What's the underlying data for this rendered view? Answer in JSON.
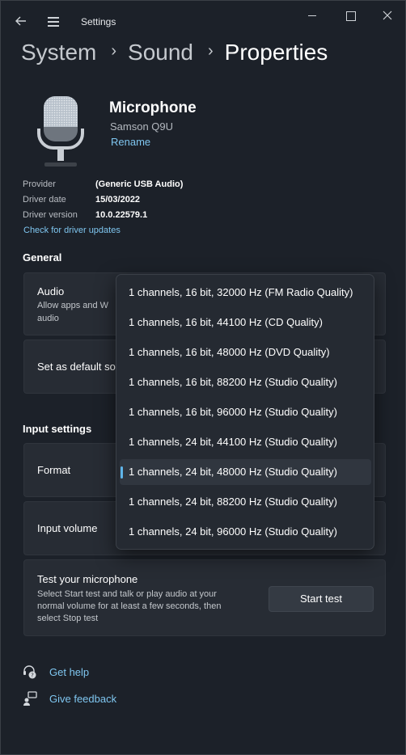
{
  "titlebar": {
    "title": "Settings",
    "back_icon": "back-arrow-icon",
    "menu_icon": "hamburger-icon"
  },
  "breadcrumb": {
    "items": [
      "System",
      "Sound",
      "Properties"
    ],
    "separator": "›"
  },
  "device": {
    "name": "Microphone",
    "model": "Samson Q9U",
    "rename_label": "Rename",
    "properties": [
      {
        "label": "Provider",
        "value": "(Generic USB Audio)"
      },
      {
        "label": "Driver date",
        "value": "15/03/2022"
      },
      {
        "label": "Driver version",
        "value": "10.0.22579.1"
      }
    ],
    "driver_update_link": "Check for driver updates"
  },
  "general": {
    "title": "General",
    "audio_title": "Audio",
    "audio_sub_1": "Allow apps and W",
    "audio_sub_2": "audio",
    "default_label": "Set as default so"
  },
  "input_settings": {
    "title": "Input settings",
    "format_label": "Format",
    "volume_label": "Input volume"
  },
  "test": {
    "title": "Test your microphone",
    "desc_1": "Select Start test and talk or play audio at your",
    "desc_2": "normal volume for at least a few seconds, then",
    "desc_3": "select Stop test",
    "button_label": "Start test"
  },
  "help": {
    "get_help": "Get help",
    "give_feedback": "Give feedback"
  },
  "format_dropdown": {
    "options": [
      "1 channels, 16 bit, 32000 Hz (FM Radio Quality)",
      "1 channels, 16 bit, 44100 Hz (CD Quality)",
      "1 channels, 16 bit, 48000 Hz (DVD Quality)",
      "1 channels, 16 bit, 88200 Hz (Studio Quality)",
      "1 channels, 16 bit, 96000 Hz (Studio Quality)",
      "1 channels, 24 bit, 44100 Hz (Studio Quality)",
      "1 channels, 24 bit, 48000 Hz (Studio Quality)",
      "1 channels, 24 bit, 88200 Hz (Studio Quality)",
      "1 channels, 24 bit, 96000 Hz (Studio Quality)"
    ],
    "selected_index": 6
  },
  "colors": {
    "accent": "#5fb5ea",
    "link": "#7fc6f0",
    "background": "#1c2129",
    "card": "#272c34"
  }
}
